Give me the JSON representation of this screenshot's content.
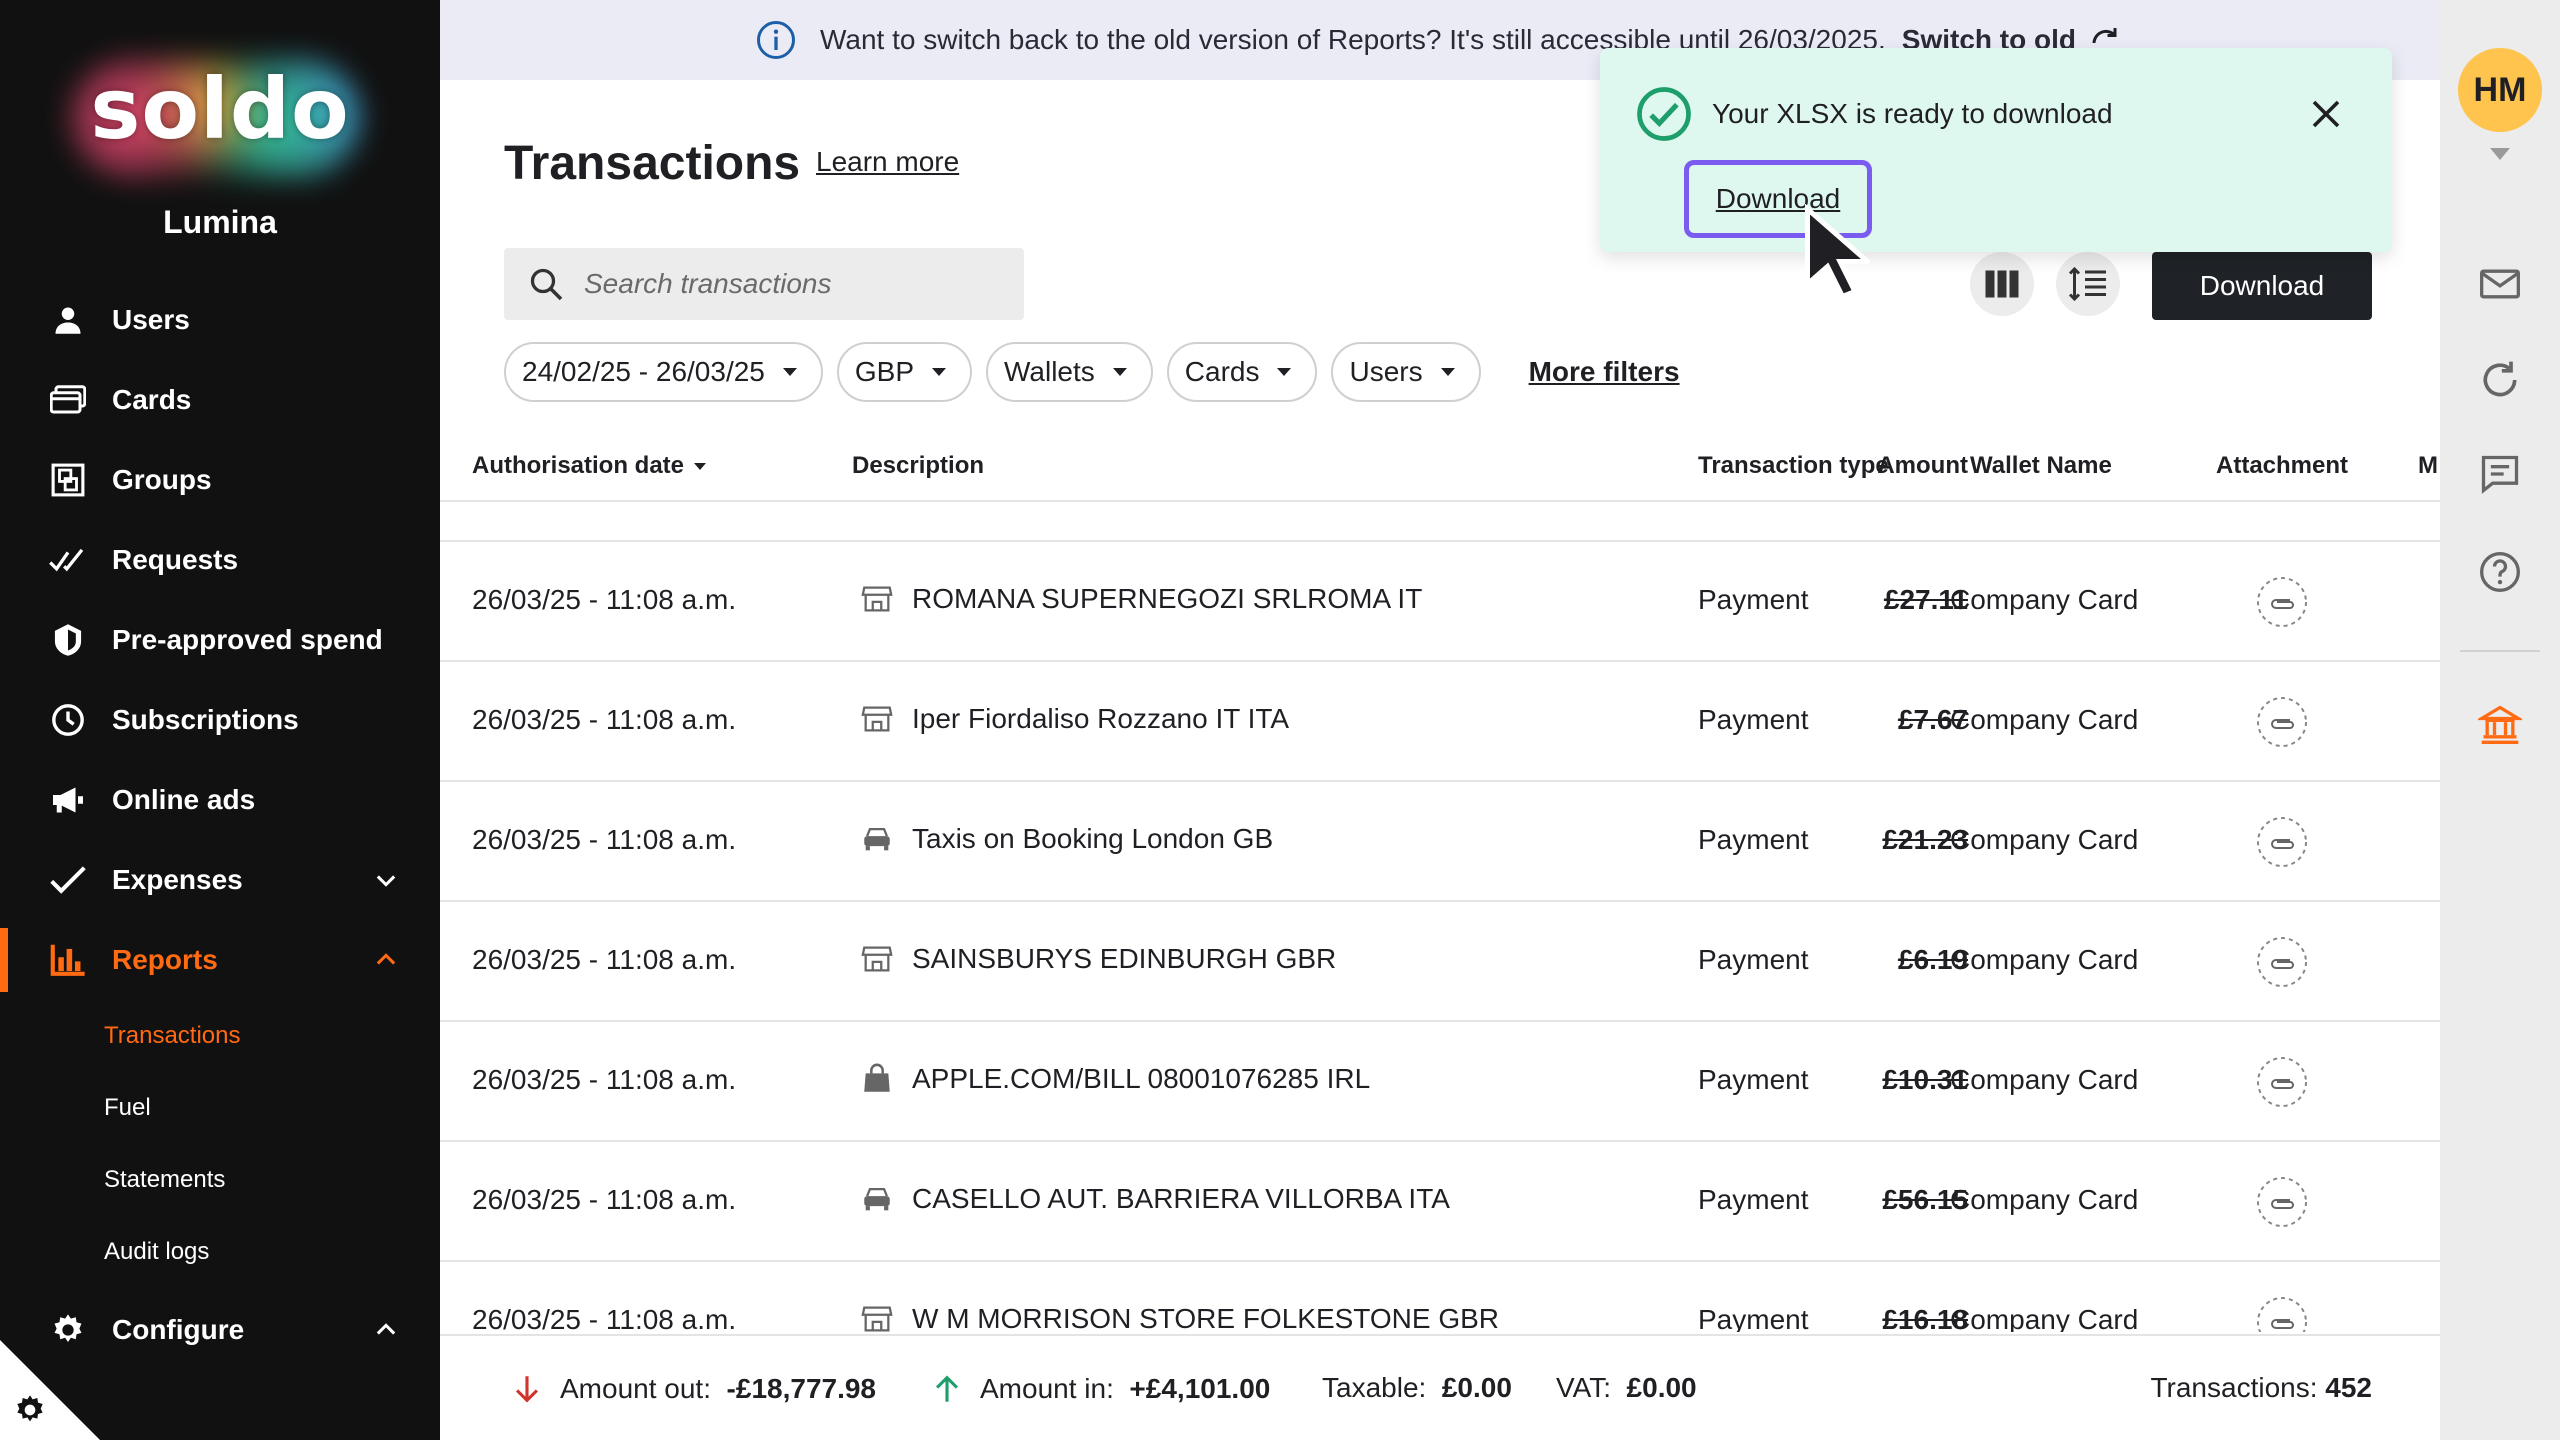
{
  "sidebar": {
    "logo_text": "soldo",
    "org_name": "Lumina",
    "items": [
      {
        "label": "Users",
        "icon": "user-icon"
      },
      {
        "label": "Cards",
        "icon": "card-icon"
      },
      {
        "label": "Groups",
        "icon": "groups-icon"
      },
      {
        "label": "Requests",
        "icon": "requests-icon"
      },
      {
        "label": "Pre-approved spend",
        "icon": "shield-icon"
      },
      {
        "label": "Subscriptions",
        "icon": "clock-icon"
      },
      {
        "label": "Online ads",
        "icon": "megaphone-icon"
      },
      {
        "label": "Expenses",
        "icon": "check-icon"
      },
      {
        "label": "Reports",
        "icon": "bar-chart-icon"
      },
      {
        "label": "Configure",
        "icon": "gear-icon"
      }
    ],
    "reports_sub": [
      "Transactions",
      "Fuel",
      "Statements",
      "Audit logs"
    ],
    "accent_color": "#ff6a13"
  },
  "banner": {
    "text": "Want to switch back to the old version of Reports? It's still accessible until 26/03/2025.",
    "switch_label": "Switch to old"
  },
  "header": {
    "title": "Transactions",
    "learn_more": "Learn more",
    "download_label": "Download"
  },
  "search": {
    "placeholder": "Search transactions"
  },
  "filters": {
    "date_range": "24/02/25 - 26/03/25",
    "currency": "GBP",
    "wallets": "Wallets",
    "cards": "Cards",
    "users": "Users",
    "more": "More filters"
  },
  "table": {
    "columns": {
      "date": "Authorisation date",
      "description": "Description",
      "amount": "Amount",
      "type": "Transaction type",
      "wallet": "Wallet Name",
      "attachment": "Attachment",
      "more": "M"
    },
    "rows": [
      {
        "date": "26/03/25 - 11:08 a.m.",
        "merchant_icon": "store-icon",
        "description": "ROMANA SUPERNEGOZI SRLROMA IT",
        "amount": "£27.11",
        "type": "Payment",
        "wallet": "Company Card"
      },
      {
        "date": "26/03/25 - 11:08 a.m.",
        "merchant_icon": "store-icon",
        "description": "Iper Fiordaliso Rozzano IT ITA",
        "amount": "£7.67",
        "type": "Payment",
        "wallet": "Company Card"
      },
      {
        "date": "26/03/25 - 11:08 a.m.",
        "merchant_icon": "car-icon",
        "description": "Taxis on Booking London GB",
        "amount": "£21.23",
        "type": "Payment",
        "wallet": "Company Card"
      },
      {
        "date": "26/03/25 - 11:08 a.m.",
        "merchant_icon": "store-icon",
        "description": "SAINSBURYS EDINBURGH GBR",
        "amount": "£6.19",
        "type": "Payment",
        "wallet": "Company Card"
      },
      {
        "date": "26/03/25 - 11:08 a.m.",
        "merchant_icon": "bag-icon",
        "description": "APPLE.COM/BILL 08001076285 IRL",
        "amount": "£10.31",
        "type": "Payment",
        "wallet": "Company Card"
      },
      {
        "date": "26/03/25 - 11:08 a.m.",
        "merchant_icon": "car-icon",
        "description": "CASELLO AUT. BARRIERA VILLORBA ITA",
        "amount": "£56.15",
        "type": "Payment",
        "wallet": "Company Card"
      },
      {
        "date": "26/03/25 - 11:08 a.m.",
        "merchant_icon": "store-icon",
        "description": "W M MORRISON STORE FOLKESTONE GBR",
        "amount": "£16.18",
        "type": "Payment",
        "wallet": "Company Card"
      }
    ]
  },
  "footer": {
    "amount_out_label": "Amount out:",
    "amount_out": "-£18,777.98",
    "amount_in_label": "Amount in:",
    "amount_in": "+£4,101.00",
    "taxable_label": "Taxable:",
    "taxable": "£0.00",
    "vat_label": "VAT:",
    "vat": "£0.00",
    "transactions_label": "Transactions:",
    "transactions": "452"
  },
  "rail": {
    "avatar": "HM"
  },
  "toast": {
    "message": "Your XLSX is ready to download",
    "link": "Download",
    "bg_color": "#dff8ef",
    "focus_color": "#7b5cf0"
  }
}
